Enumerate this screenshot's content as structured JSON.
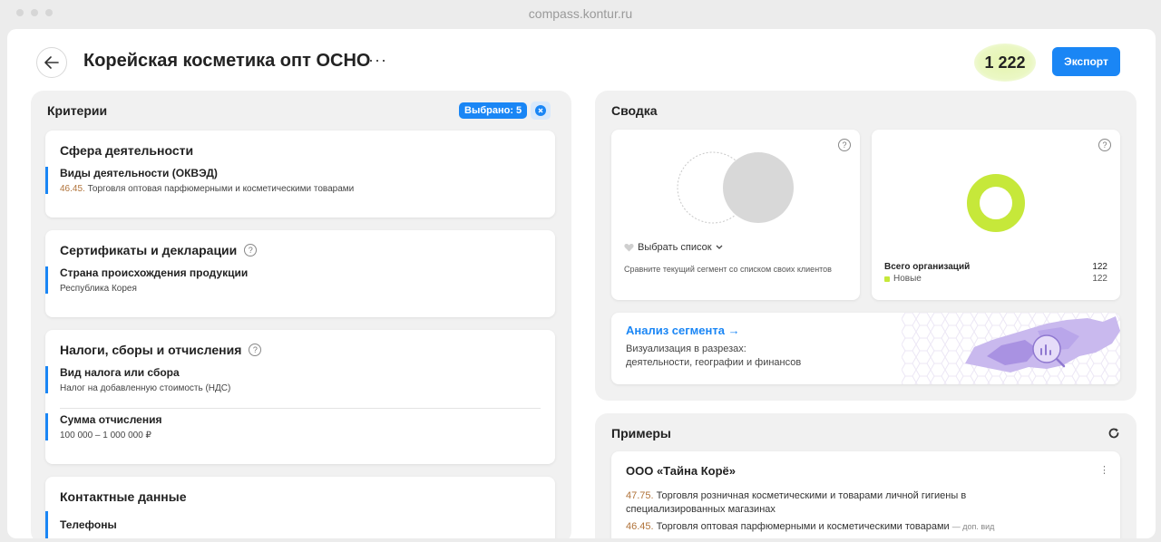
{
  "browser": {
    "url": "compass.kontur.ru"
  },
  "header": {
    "title": "Корейская косметика опт ОСНО",
    "more_label": "···",
    "count": "1 222",
    "export_label": "Экспорт"
  },
  "criteria": {
    "heading": "Критерии",
    "selected_label": "Выбрано: 5",
    "cards": [
      {
        "title": "Сфера деятельности",
        "label": "Виды деятельности (ОКВЭД)",
        "code": "46.45.",
        "value": "Торговля оптовая парфюмерными и косметическими товарами"
      },
      {
        "title": "Сертификаты и декларации",
        "label": "Страна происхождения продукции",
        "value": "Республика Корея"
      },
      {
        "title": "Налоги, сборы и отчисления",
        "label": "Вид налога или сбора",
        "value": "Налог на добавленную стоимость (НДС)",
        "label2": "Сумма отчисления",
        "value2": "100 000 – 1 000 000 ₽"
      },
      {
        "title": "Контактные данные",
        "label": "Телефоны"
      }
    ]
  },
  "summary": {
    "heading": "Сводка",
    "compare": {
      "select_label": "Выбрать список",
      "description": "Сравните текущий сегмент со списком своих клиентов"
    },
    "orgs": {
      "total_label": "Всего организаций",
      "total_value": "122",
      "new_label": "Новые",
      "new_value": "122",
      "new_color": "#c6e83a"
    },
    "analysis": {
      "title": "Анализ сегмента →",
      "line1": "Визуализация в разрезах:",
      "line2": "деятельности, географии и финансов"
    }
  },
  "examples": {
    "heading": "Примеры",
    "company": {
      "name": "ООО «Тайна Корё»",
      "code1": "47.75.",
      "activity1": "Торговля розничная косметическими и товарами личной гигиены в специализированных магазинах",
      "code2": "46.45.",
      "activity2": "Торговля оптовая парфюмерными и косметическими товарами",
      "suffix2": "— доп. вид"
    }
  },
  "colors": {
    "accent": "#1a86f5",
    "donut": "#c6e83a",
    "code": "#b0733a"
  }
}
